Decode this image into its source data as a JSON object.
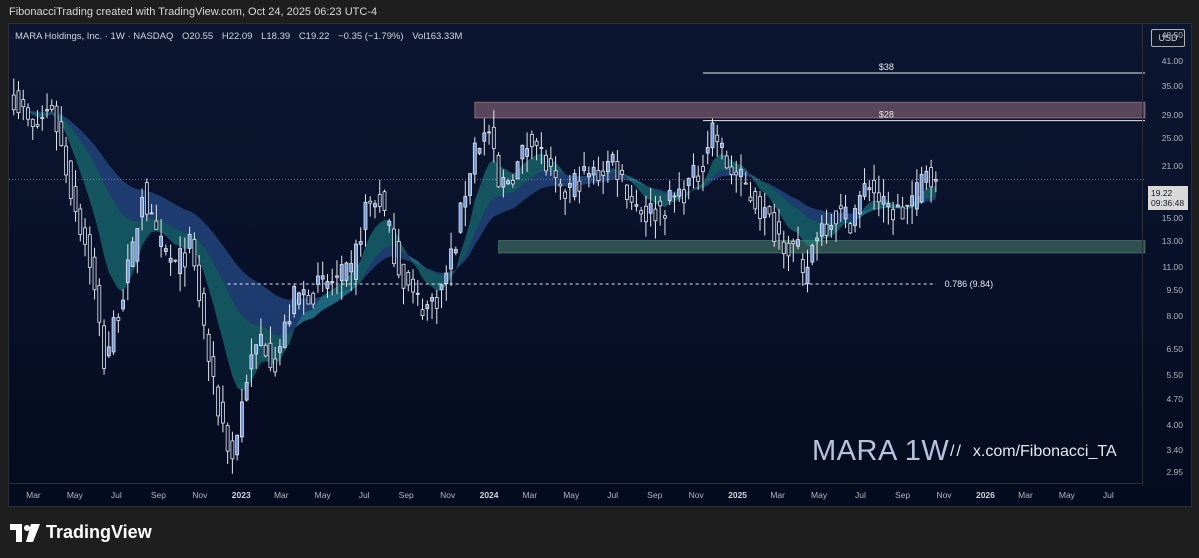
{
  "attribution": "FibonacciTrading created with TradingView.com, Oct 24, 2025 06:23 UTC-4",
  "legend": {
    "symbol": "MARA Holdings, Inc. · 1W · NASDAQ",
    "open": "O20.55",
    "high": "H22.09",
    "low": "L18.39",
    "close": "C19.22",
    "change": "−0.35 (−1.79%)",
    "volume": "Vol163.33M"
  },
  "currency_button": "USD",
  "last_price": {
    "value": "19.22",
    "countdown": "09:36:48"
  },
  "watermark": {
    "ticker": "MARA 1W",
    "sep": "//",
    "handle": "x.com/Fibonacci_TA"
  },
  "footer": {
    "brand": "TradingView"
  },
  "colors": {
    "background": "#0a1330",
    "candle": "#e6e8ee",
    "bull_fill": "#6f95d6",
    "ema_dark": "#2f5ea8",
    "ema_teal": "#1d8c8c",
    "resistance_zone": "#e8a2ac",
    "support_zone": "#5f9e7f"
  },
  "chart_data": {
    "type": "candlestick",
    "symbol": "MARA",
    "timeframe": "1W",
    "y_scale": "log",
    "ylim": [
      2.7,
      52
    ],
    "price_axis_ticks": [
      "48.50",
      "41.00",
      "35.00",
      "29.00",
      "25.00",
      "21.00",
      "19.22",
      "15.00",
      "13.00",
      "11.00",
      "9.50",
      "8.00",
      "6.50",
      "5.50",
      "4.70",
      "4.00",
      "3.40",
      "2.95"
    ],
    "time_axis_ticks": [
      {
        "label": "Mar",
        "year": false
      },
      {
        "label": "May",
        "year": false
      },
      {
        "label": "Jul",
        "year": false
      },
      {
        "label": "Sep",
        "year": false
      },
      {
        "label": "Nov",
        "year": false
      },
      {
        "label": "2023",
        "year": true
      },
      {
        "label": "Mar",
        "year": false
      },
      {
        "label": "May",
        "year": false
      },
      {
        "label": "Jul",
        "year": false
      },
      {
        "label": "Sep",
        "year": false
      },
      {
        "label": "Nov",
        "year": false
      },
      {
        "label": "2024",
        "year": true
      },
      {
        "label": "Mar",
        "year": false
      },
      {
        "label": "May",
        "year": false
      },
      {
        "label": "Jul",
        "year": false
      },
      {
        "label": "Sep",
        "year": false
      },
      {
        "label": "Nov",
        "year": false
      },
      {
        "label": "2025",
        "year": true
      },
      {
        "label": "Mar",
        "year": false
      },
      {
        "label": "May",
        "year": false
      },
      {
        "label": "Jul",
        "year": false
      },
      {
        "label": "Sep",
        "year": false
      },
      {
        "label": "Nov",
        "year": false
      },
      {
        "label": "2026",
        "year": true
      },
      {
        "label": "Mar",
        "year": false
      },
      {
        "label": "May",
        "year": false
      },
      {
        "label": "Jul",
        "year": false
      }
    ],
    "horizontal_levels": [
      {
        "label": "$38",
        "value": 38
      },
      {
        "label": "$28",
        "value": 28
      },
      {
        "label": "0.786 (9.84)",
        "value": 9.84,
        "style": "dashed"
      }
    ],
    "zones": [
      {
        "name": "resistance",
        "low": 28.5,
        "high": 31.5
      },
      {
        "name": "support",
        "low": 12.0,
        "high": 13.0
      }
    ],
    "price_path": [
      [
        "2022-01-31",
        33.0
      ],
      [
        "2022-02-28",
        26.0
      ],
      [
        "2022-03-28",
        31.0
      ],
      [
        "2022-04-25",
        18.0
      ],
      [
        "2022-05-23",
        11.5
      ],
      [
        "2022-06-13",
        6.0
      ],
      [
        "2022-06-27",
        7.5
      ],
      [
        "2022-07-25",
        12.0
      ],
      [
        "2022-08-08",
        18.0
      ],
      [
        "2022-08-29",
        13.0
      ],
      [
        "2022-09-26",
        11.0
      ],
      [
        "2022-10-17",
        12.5
      ],
      [
        "2022-10-31",
        9.0
      ],
      [
        "2022-11-21",
        5.0
      ],
      [
        "2022-12-19",
        3.2
      ],
      [
        "2023-01-09",
        5.5
      ],
      [
        "2023-01-30",
        7.0
      ],
      [
        "2023-02-20",
        6.0
      ],
      [
        "2023-03-20",
        9.0
      ],
      [
        "2023-04-17",
        9.5
      ],
      [
        "2023-05-15",
        10.0
      ],
      [
        "2023-06-12",
        10.5
      ],
      [
        "2023-07-03",
        16.0
      ],
      [
        "2023-07-24",
        17.0
      ],
      [
        "2023-08-21",
        11.0
      ],
      [
        "2023-09-11",
        9.0
      ],
      [
        "2023-10-02",
        8.5
      ],
      [
        "2023-10-23",
        9.5
      ],
      [
        "2023-11-13",
        13.0
      ],
      [
        "2023-11-27",
        18.0
      ],
      [
        "2023-12-11",
        24.0
      ],
      [
        "2024-01-01",
        26.0
      ],
      [
        "2024-01-15",
        18.0
      ],
      [
        "2024-02-12",
        21.0
      ],
      [
        "2024-03-04",
        26.0
      ],
      [
        "2024-03-25",
        21.0
      ],
      [
        "2024-04-15",
        17.0
      ],
      [
        "2024-05-13",
        19.5
      ],
      [
        "2024-06-10",
        20.0
      ],
      [
        "2024-07-01",
        22.0
      ],
      [
        "2024-07-29",
        17.0
      ],
      [
        "2024-08-19",
        15.5
      ],
      [
        "2024-09-09",
        16.0
      ],
      [
        "2024-10-07",
        17.5
      ],
      [
        "2024-11-04",
        20.0
      ],
      [
        "2024-11-25",
        27.0
      ],
      [
        "2024-12-16",
        21.0
      ],
      [
        "2025-01-06",
        19.0
      ],
      [
        "2025-02-03",
        16.0
      ],
      [
        "2025-03-03",
        13.5
      ],
      [
        "2025-03-31",
        12.0
      ],
      [
        "2025-04-07",
        9.9
      ],
      [
        "2025-04-28",
        14.0
      ],
      [
        "2025-05-26",
        15.5
      ],
      [
        "2025-06-16",
        15.0
      ],
      [
        "2025-07-14",
        19.0
      ],
      [
        "2025-08-04",
        16.0
      ],
      [
        "2025-09-01",
        15.5
      ],
      [
        "2025-09-22",
        17.5
      ],
      [
        "2025-10-06",
        21.0
      ],
      [
        "2025-10-20",
        19.22
      ]
    ]
  }
}
